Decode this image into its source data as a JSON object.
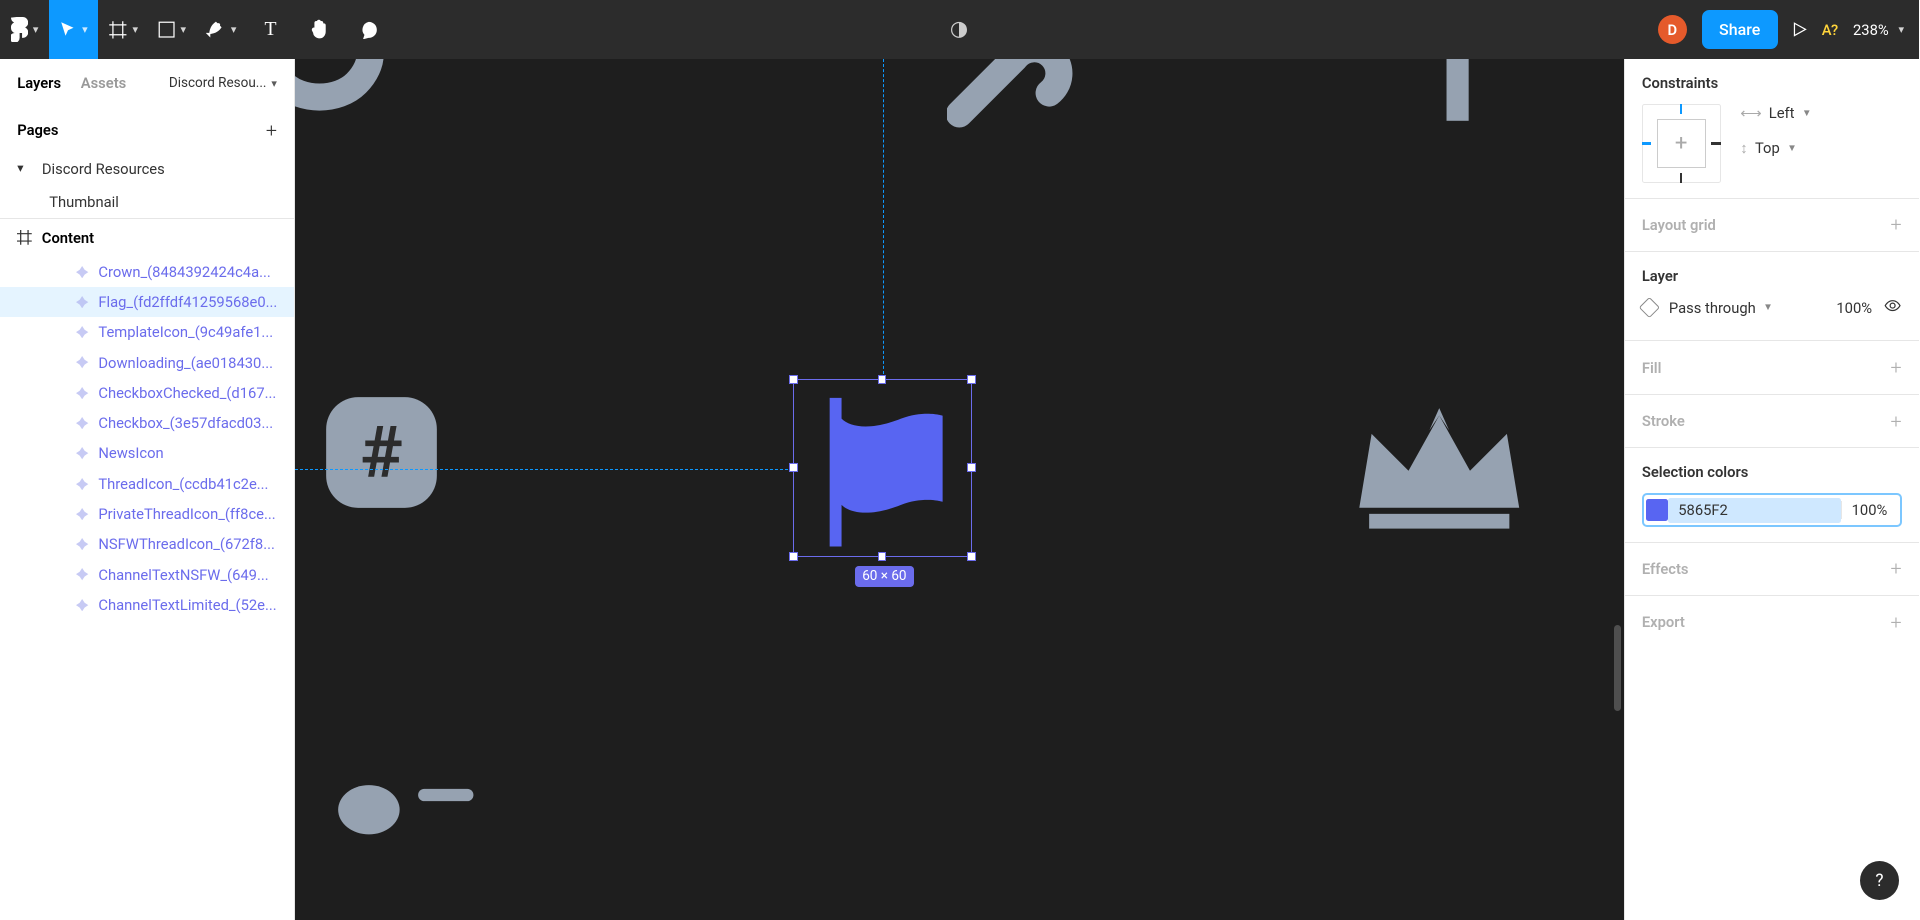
{
  "topbar": {
    "zoom": "238%",
    "missing_fonts": "A?",
    "avatar_initial": "D",
    "share_label": "Share"
  },
  "left_panel": {
    "tabs": {
      "layers": "Layers",
      "assets": "Assets"
    },
    "file_name": "Discord Resou...",
    "pages_label": "Pages",
    "pages": [
      {
        "name": "Discord Resources",
        "expanded": true
      },
      {
        "name": "Thumbnail",
        "expanded": false
      }
    ],
    "frame_section": "Content",
    "layers": [
      {
        "name": "Crown_(8484392424c4a...",
        "selected": false
      },
      {
        "name": "Flag_(fd2ffdf41259568e0...",
        "selected": true
      },
      {
        "name": "TemplateIcon_(9c49afe1...",
        "selected": false
      },
      {
        "name": "Downloading_(ae018430...",
        "selected": false
      },
      {
        "name": "CheckboxChecked_(d167...",
        "selected": false
      },
      {
        "name": "Checkbox_(3e57dfacd03...",
        "selected": false
      },
      {
        "name": "NewsIcon",
        "selected": false
      },
      {
        "name": "ThreadIcon_(ccdb41c2e...",
        "selected": false
      },
      {
        "name": "PrivateThreadIcon_(ff8ce...",
        "selected": false
      },
      {
        "name": "NSFWThreadIcon_(672f8...",
        "selected": false
      },
      {
        "name": "ChannelTextNSFW_(649...",
        "selected": false
      },
      {
        "name": "ChannelTextLimited_(52e...",
        "selected": false
      }
    ]
  },
  "canvas": {
    "selection_dims": "60 × 60"
  },
  "right_panel": {
    "constraints_label": "Constraints",
    "constraint_h": "Left",
    "constraint_v": "Top",
    "layout_grid_label": "Layout grid",
    "layer_label": "Layer",
    "blend_mode": "Pass through",
    "layer_opacity": "100%",
    "fill_label": "Fill",
    "stroke_label": "Stroke",
    "selection_colors_label": "Selection colors",
    "selection_color_hex": "5865F2",
    "selection_color_opacity": "100%",
    "effects_label": "Effects",
    "export_label": "Export"
  },
  "colors": {
    "accent": "#0D99FF",
    "selection": "#6B6CEC",
    "canvas_bg": "#1E1E1E",
    "flag": "#5865F2",
    "icon_grey": "#96A2B1"
  }
}
